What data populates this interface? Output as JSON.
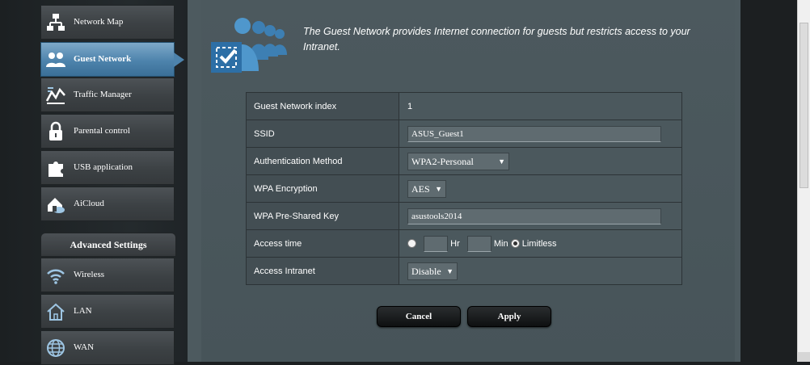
{
  "sidebar": {
    "general_items": [
      {
        "label": "Network Map",
        "icon": "network-map-icon"
      },
      {
        "label": "Guest Network",
        "icon": "guest-network-icon",
        "active": true
      },
      {
        "label": "Traffic Manager",
        "icon": "traffic-manager-icon"
      },
      {
        "label": "Parental control",
        "icon": "parental-control-icon"
      },
      {
        "label": "USB application",
        "icon": "usb-application-icon"
      },
      {
        "label": "AiCloud",
        "icon": "aicloud-icon"
      }
    ],
    "advanced_header": "Advanced Settings",
    "advanced_items": [
      {
        "label": "Wireless",
        "icon": "wireless-icon"
      },
      {
        "label": "LAN",
        "icon": "lan-icon"
      },
      {
        "label": "WAN",
        "icon": "wan-icon"
      }
    ]
  },
  "intro": {
    "text": "The Guest Network provides Internet connection for guests but restricts access to your Intranet."
  },
  "settings": {
    "index_label": "Guest Network index",
    "index_value": "1",
    "ssid_label": "SSID",
    "ssid_value": "ASUS_Guest1",
    "auth_label": "Authentication Method",
    "auth_value": "WPA2-Personal",
    "enc_label": "WPA Encryption",
    "enc_value": "AES",
    "psk_label": "WPA Pre-Shared Key",
    "psk_value": "asustools2014",
    "access_time_label": "Access time",
    "hr_label": "Hr",
    "min_label": "Min",
    "limitless_label": "Limitless",
    "intranet_label": "Access Intranet",
    "intranet_value": "Disable"
  },
  "buttons": {
    "cancel": "Cancel",
    "apply": "Apply"
  },
  "colors": {
    "active_menu": "#4d83ac",
    "panel_bg": "#4b585d",
    "page_bg": "#1c1f21"
  }
}
